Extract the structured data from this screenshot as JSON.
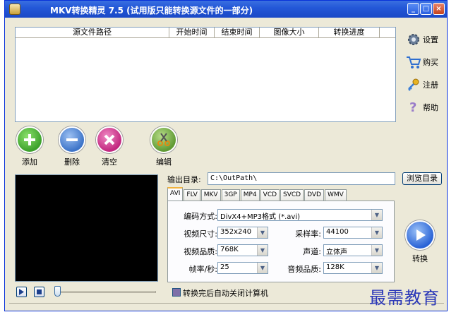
{
  "window": {
    "title": "MKV转换精灵 7.5 (试用版只能转换源文件的一部分)",
    "minimize": "_",
    "maximize": "□",
    "close": "×"
  },
  "file_list": {
    "columns": [
      "源文件路径",
      "开始时间",
      "结束时间",
      "图像大小",
      "转换进度"
    ]
  },
  "side_menu": {
    "settings": "设置",
    "buy": "购买",
    "register": "注册",
    "help": "帮助"
  },
  "actions": {
    "add": "添加",
    "delete": "删除",
    "clear": "清空",
    "edit": "编辑"
  },
  "output": {
    "label": "输出目录:",
    "path": "C:\\OutPath\\",
    "browse": "浏览目录"
  },
  "tabs": [
    "AVI",
    "FLV",
    "MKV",
    "3GP",
    "MP4",
    "VCD",
    "SVCD",
    "DVD",
    "WMV"
  ],
  "settings_panel": {
    "codec_label": "编码方式:",
    "codec_value": "DivX4+MP3格式 (*.avi)",
    "size_label": "视频尺寸:",
    "size_value": "352x240",
    "sample_rate_label": "采样率:",
    "sample_rate_value": "44100",
    "video_quality_label": "视频品质:",
    "video_quality_value": "768K",
    "channel_label": "声道:",
    "channel_value": "立体声",
    "fps_label": "帧率/秒:",
    "fps_value": "25",
    "audio_quality_label": "音频品质:",
    "audio_quality_value": "128K"
  },
  "convert": {
    "label": "转换"
  },
  "shutdown_checkbox": {
    "label": "转换完后自动关闭计算机"
  },
  "watermark": "最需教育",
  "colors": {
    "titlebar": "#2458d8",
    "window_bg": "#ece9d8",
    "add_green": "#3da12c",
    "delete_blue": "#3d74c8",
    "clear_magenta": "#c2277f",
    "convert_blue": "#2a63d6"
  }
}
